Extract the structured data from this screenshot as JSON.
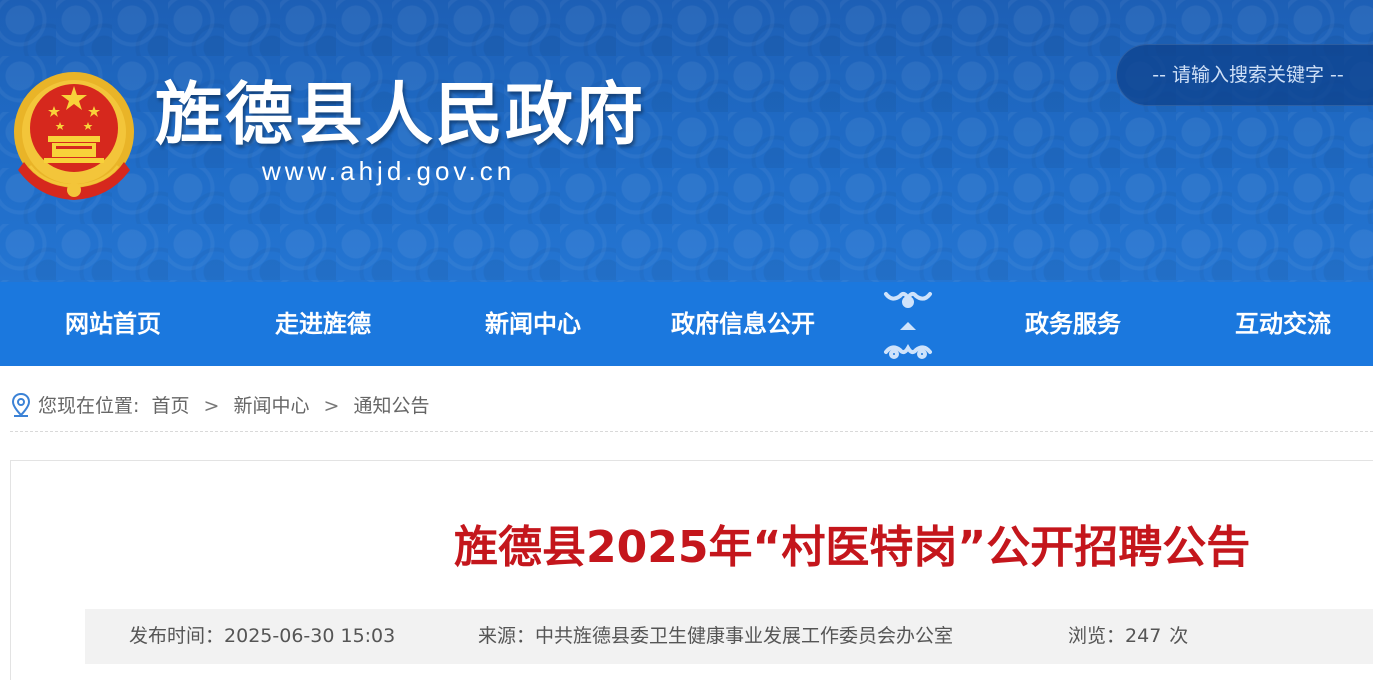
{
  "header": {
    "site_name": "旌德县人民政府",
    "site_url": "www.ahjd.gov.cn",
    "emblem_icon": "national-emblem-icon",
    "search_placeholder": "-- 请输入搜索关键字 --",
    "colors": {
      "banner": "#1f6ac4",
      "nav": "#1b78de",
      "title_red": "#c4161c"
    }
  },
  "nav": {
    "items": [
      {
        "label": "网站首页"
      },
      {
        "label": "走进旌德"
      },
      {
        "label": "新闻中心"
      },
      {
        "label": "政府信息公开"
      },
      {
        "label": "政务服务"
      },
      {
        "label": "互动交流"
      }
    ],
    "ornament_icon": "cloud-scroll-ornament-icon"
  },
  "breadcrumb": {
    "icon": "location-pin-icon",
    "prefix": "您现在位置:",
    "items": [
      "首页",
      "新闻中心",
      "通知公告"
    ],
    "separator": ">"
  },
  "article": {
    "title": "旌德县2025年“村医特岗”公开招聘公告",
    "publish_label": "发布时间：",
    "publish_time": "2025-06-30 15:03",
    "source_label": "来源：",
    "source": "中共旌德县委卫生健康事业发展工作委员会办公室",
    "views_label": "浏览：",
    "views": "247",
    "views_unit": "次"
  }
}
